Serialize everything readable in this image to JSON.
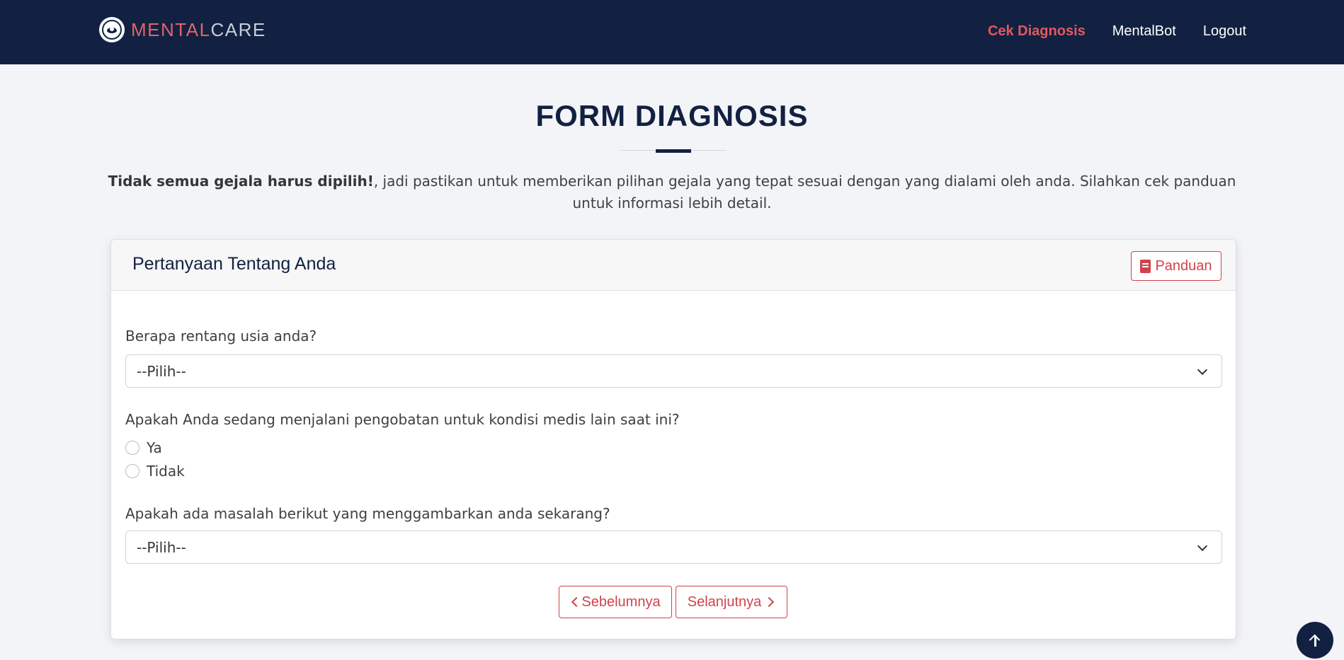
{
  "navbar": {
    "brand_part1": "MENTAL",
    "brand_part2": "CARE",
    "links": [
      {
        "label": "Cek Diagnosis"
      },
      {
        "label": "MentalBot"
      },
      {
        "label": "Logout"
      }
    ]
  },
  "header": {
    "title": "FORM DIAGNOSIS",
    "intro_bold": "Tidak semua gejala harus dipilih!",
    "intro_rest": ", jadi pastikan untuk memberikan pilihan gejala yang tepat sesuai dengan yang dialami oleh anda. Silahkan cek panduan untuk informasi lebih detail."
  },
  "card": {
    "title": "Pertanyaan Tentang Anda",
    "guide_button": "Panduan",
    "questions": [
      {
        "label": "Berapa rentang usia anda?",
        "selected": "--Pilih--"
      },
      {
        "label": "Apakah Anda sedang menjalani pengobatan untuk kondisi medis lain saat ini?",
        "options": [
          "Ya",
          "Tidak"
        ]
      },
      {
        "label": "Apakah ada masalah berikut yang menggambarkan anda sekarang?",
        "selected": "--Pilih--"
      }
    ],
    "prev_button": "Sebelumnya",
    "next_button": "Selanjutnya"
  },
  "colors": {
    "navbar_bg": "#122142",
    "accent": "#d1434a",
    "page_bg": "#f3f4f7"
  },
  "icons": [
    "brand-logo-icon",
    "book-icon",
    "chevron-down-icon",
    "chevron-left-icon",
    "chevron-right-icon",
    "arrow-up-icon"
  ]
}
